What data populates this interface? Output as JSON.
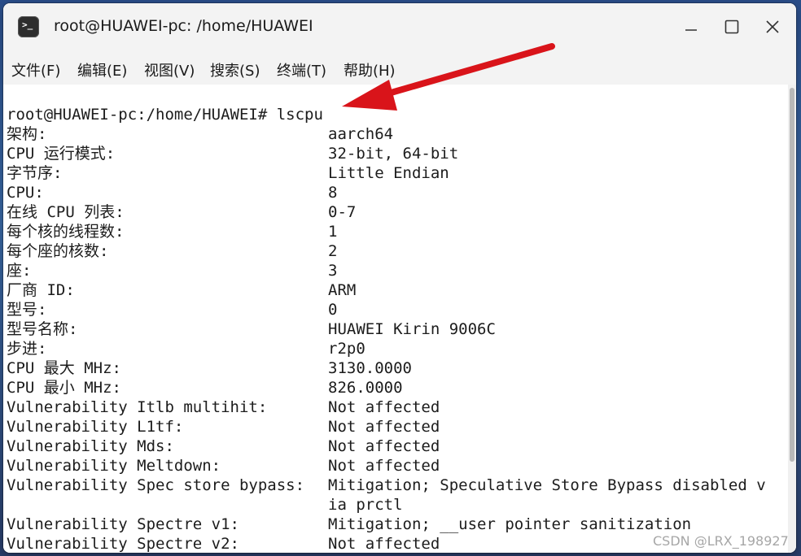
{
  "window": {
    "title": "root@HUAWEI-pc: /home/HUAWEI",
    "app_icon_glyph": ">_"
  },
  "menu": [
    "文件(F)",
    "编辑(E)",
    "视图(V)",
    "搜索(S)",
    "终端(T)",
    "帮助(H)"
  ],
  "terminal": {
    "prompt": "root@HUAWEI-pc:/home/HUAWEI# lscpu",
    "rows": [
      {
        "label": "架构:",
        "value": "aarch64"
      },
      {
        "label": "CPU 运行模式:",
        "value": "32-bit, 64-bit"
      },
      {
        "label": "字节序:",
        "value": "Little Endian"
      },
      {
        "label": "CPU:",
        "value": "8"
      },
      {
        "label": "在线 CPU 列表:",
        "value": "0-7"
      },
      {
        "label": "每个核的线程数:",
        "value": "1"
      },
      {
        "label": "每个座的核数:",
        "value": "2"
      },
      {
        "label": "座:",
        "value": "3"
      },
      {
        "label": "厂商 ID:",
        "value": "ARM"
      },
      {
        "label": "型号:",
        "value": "0"
      },
      {
        "label": "型号名称:",
        "value": "HUAWEI Kirin 9006C"
      },
      {
        "label": "步进:",
        "value": "r2p0"
      },
      {
        "label": "CPU 最大 MHz:",
        "value": "3130.0000"
      },
      {
        "label": "CPU 最小 MHz:",
        "value": "826.0000"
      },
      {
        "label": "Vulnerability Itlb multihit:",
        "value": "Not affected"
      },
      {
        "label": "Vulnerability L1tf:",
        "value": "Not affected"
      },
      {
        "label": "Vulnerability Mds:",
        "value": "Not affected"
      },
      {
        "label": "Vulnerability Meltdown:",
        "value": "Not affected"
      },
      {
        "label": "Vulnerability Spec store bypass:",
        "value": "Mitigation; Speculative Store Bypass disabled v"
      },
      {
        "label": "",
        "value": "ia prctl"
      },
      {
        "label": "Vulnerability Spectre v1:",
        "value": "Mitigation; __user pointer sanitization"
      },
      {
        "label": "Vulnerability Spectre v2:",
        "value": "Not affected"
      }
    ]
  },
  "annotation": {
    "arrow_color": "#d9141a"
  },
  "watermark": "CSDN @LRX_198927"
}
